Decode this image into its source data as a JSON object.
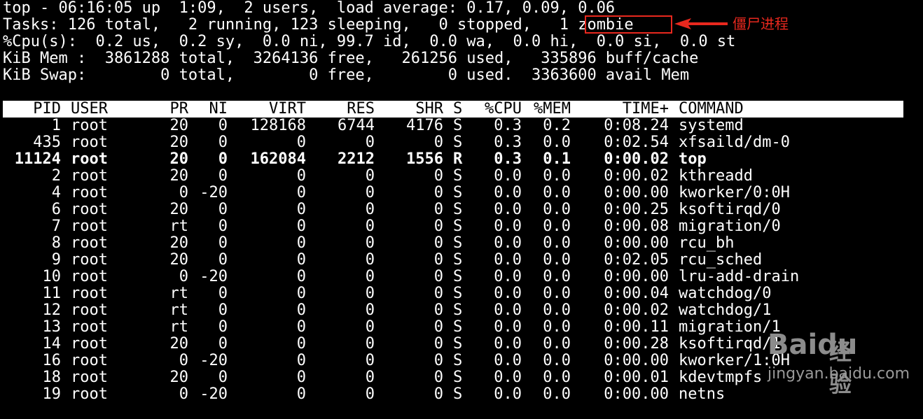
{
  "summary": {
    "line1": "top - 06:16:05 up  1:09,  2 users,  load average: 0.17, 0.09, 0.06",
    "line2": "Tasks: 126 total,   2 running, 123 sleeping,   0 stopped,   1 zombie",
    "line3": "%Cpu(s):  0.2 us,  0.2 sy,  0.0 ni, 99.7 id,  0.0 wa,  0.0 hi,  0.0 si,  0.0 st",
    "line4": "KiB Mem :  3861288 total,  3264136 free,   261256 used,   335896 buff/cache",
    "line5": "KiB Swap:        0 total,        0 free,        0 used.  3363600 avail Mem"
  },
  "annotation": {
    "label": "僵尸进程",
    "highlight_color": "#e8281e"
  },
  "columns": {
    "pid": "PID",
    "user": "USER",
    "pr": "PR",
    "ni": "NI",
    "virt": "VIRT",
    "res": "RES",
    "shr": "SHR",
    "s": "S",
    "cpu": "%CPU",
    "mem": "%MEM",
    "time": "TIME+",
    "command": "COMMAND"
  },
  "processes": [
    {
      "pid": "1",
      "user": "root",
      "pr": "20",
      "ni": "0",
      "virt": "128168",
      "res": "6744",
      "shr": "4176",
      "s": "S",
      "cpu": "0.3",
      "mem": "0.2",
      "time": "0:08.24",
      "command": "systemd"
    },
    {
      "pid": "435",
      "user": "root",
      "pr": "20",
      "ni": "0",
      "virt": "0",
      "res": "0",
      "shr": "0",
      "s": "S",
      "cpu": "0.3",
      "mem": "0.0",
      "time": "0:02.54",
      "command": "xfsaild/dm-0"
    },
    {
      "pid": "11124",
      "user": "root",
      "pr": "20",
      "ni": "0",
      "virt": "162084",
      "res": "2212",
      "shr": "1556",
      "s": "R",
      "cpu": "0.3",
      "mem": "0.1",
      "time": "0:00.02",
      "command": "top",
      "bold": true
    },
    {
      "pid": "2",
      "user": "root",
      "pr": "20",
      "ni": "0",
      "virt": "0",
      "res": "0",
      "shr": "0",
      "s": "S",
      "cpu": "0.0",
      "mem": "0.0",
      "time": "0:00.02",
      "command": "kthreadd"
    },
    {
      "pid": "4",
      "user": "root",
      "pr": "0",
      "ni": "-20",
      "virt": "0",
      "res": "0",
      "shr": "0",
      "s": "S",
      "cpu": "0.0",
      "mem": "0.0",
      "time": "0:00.00",
      "command": "kworker/0:0H"
    },
    {
      "pid": "6",
      "user": "root",
      "pr": "20",
      "ni": "0",
      "virt": "0",
      "res": "0",
      "shr": "0",
      "s": "S",
      "cpu": "0.0",
      "mem": "0.0",
      "time": "0:00.25",
      "command": "ksoftirqd/0"
    },
    {
      "pid": "7",
      "user": "root",
      "pr": "rt",
      "ni": "0",
      "virt": "0",
      "res": "0",
      "shr": "0",
      "s": "S",
      "cpu": "0.0",
      "mem": "0.0",
      "time": "0:00.08",
      "command": "migration/0"
    },
    {
      "pid": "8",
      "user": "root",
      "pr": "20",
      "ni": "0",
      "virt": "0",
      "res": "0",
      "shr": "0",
      "s": "S",
      "cpu": "0.0",
      "mem": "0.0",
      "time": "0:00.00",
      "command": "rcu_bh"
    },
    {
      "pid": "9",
      "user": "root",
      "pr": "20",
      "ni": "0",
      "virt": "0",
      "res": "0",
      "shr": "0",
      "s": "S",
      "cpu": "0.0",
      "mem": "0.0",
      "time": "0:02.05",
      "command": "rcu_sched"
    },
    {
      "pid": "10",
      "user": "root",
      "pr": "0",
      "ni": "-20",
      "virt": "0",
      "res": "0",
      "shr": "0",
      "s": "S",
      "cpu": "0.0",
      "mem": "0.0",
      "time": "0:00.00",
      "command": "lru-add-drain"
    },
    {
      "pid": "11",
      "user": "root",
      "pr": "rt",
      "ni": "0",
      "virt": "0",
      "res": "0",
      "shr": "0",
      "s": "S",
      "cpu": "0.0",
      "mem": "0.0",
      "time": "0:00.04",
      "command": "watchdog/0"
    },
    {
      "pid": "12",
      "user": "root",
      "pr": "rt",
      "ni": "0",
      "virt": "0",
      "res": "0",
      "shr": "0",
      "s": "S",
      "cpu": "0.0",
      "mem": "0.0",
      "time": "0:00.02",
      "command": "watchdog/1"
    },
    {
      "pid": "13",
      "user": "root",
      "pr": "rt",
      "ni": "0",
      "virt": "0",
      "res": "0",
      "shr": "0",
      "s": "S",
      "cpu": "0.0",
      "mem": "0.0",
      "time": "0:00.11",
      "command": "migration/1"
    },
    {
      "pid": "14",
      "user": "root",
      "pr": "20",
      "ni": "0",
      "virt": "0",
      "res": "0",
      "shr": "0",
      "s": "S",
      "cpu": "0.0",
      "mem": "0.0",
      "time": "0:00.28",
      "command": "ksoftirqd/1"
    },
    {
      "pid": "16",
      "user": "root",
      "pr": "0",
      "ni": "-20",
      "virt": "0",
      "res": "0",
      "shr": "0",
      "s": "S",
      "cpu": "0.0",
      "mem": "0.0",
      "time": "0:00.00",
      "command": "kworker/1:0H"
    },
    {
      "pid": "18",
      "user": "root",
      "pr": "20",
      "ni": "0",
      "virt": "0",
      "res": "0",
      "shr": "0",
      "s": "S",
      "cpu": "0.0",
      "mem": "0.0",
      "time": "0:00.01",
      "command": "kdevtmpfs"
    },
    {
      "pid": "19",
      "user": "root",
      "pr": "0",
      "ni": "-20",
      "virt": "0",
      "res": "0",
      "shr": "0",
      "s": "S",
      "cpu": "0.0",
      "mem": "0.0",
      "time": "0:00.00",
      "command": "netns"
    }
  ],
  "watermark": {
    "logo": "Baidu",
    "cn": "经验",
    "url": "jingyan.baidu.com"
  }
}
